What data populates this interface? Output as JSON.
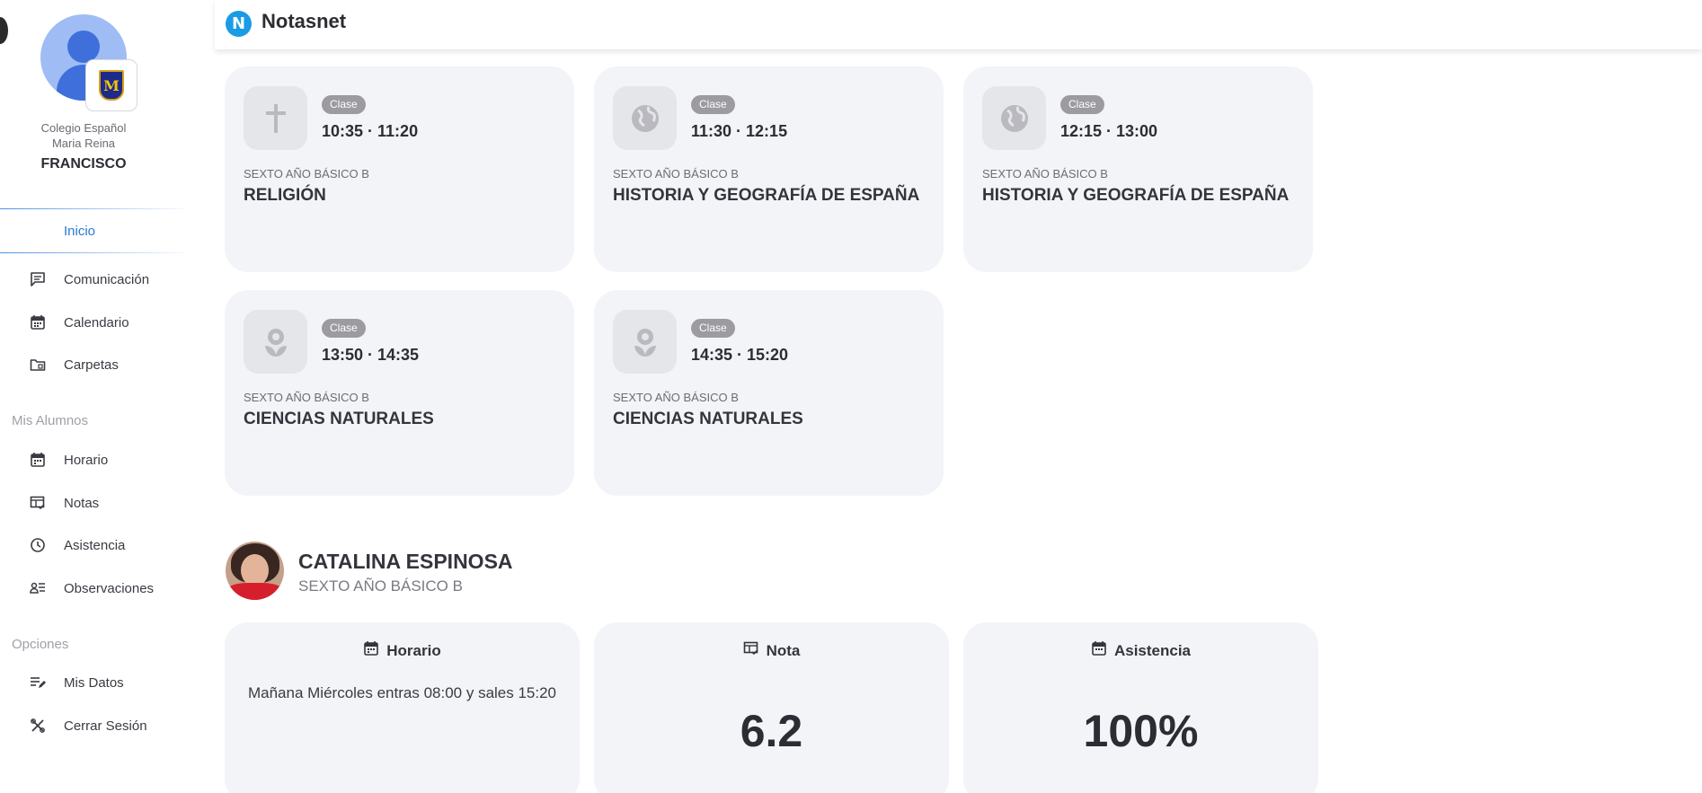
{
  "app": {
    "title": "Notasnet",
    "logo_letter": "N"
  },
  "profile": {
    "school_line1": "Colegio Español",
    "school_line2": "Maria Reina",
    "user_name": "FRANCISCO"
  },
  "nav": {
    "active_label": "Inicio",
    "main_items": [
      {
        "label": "Comunicación",
        "icon": "chat-icon"
      },
      {
        "label": "Calendario",
        "icon": "calendar-icon"
      },
      {
        "label": "Carpetas",
        "icon": "folder-icon"
      }
    ],
    "section_students": "Mis Alumnos",
    "student_items": [
      {
        "label": "Horario",
        "icon": "calendar-icon"
      },
      {
        "label": "Notas",
        "icon": "grades-table-icon"
      },
      {
        "label": "Asistencia",
        "icon": "clock-icon"
      },
      {
        "label": "Observaciones",
        "icon": "person-notes-icon"
      }
    ],
    "section_options": "Opciones",
    "option_items": [
      {
        "label": "Mis Datos",
        "icon": "edit-list-icon"
      },
      {
        "label": "Cerrar Sesión",
        "icon": "logout-tools-icon"
      }
    ]
  },
  "classes": [
    {
      "pill": "Clase",
      "time": "10:35 · 11:20",
      "grade": "SEXTO AÑO BÁSICO B",
      "subject": "RELIGIÓN",
      "icon": "cross-icon"
    },
    {
      "pill": "Clase",
      "time": "11:30 · 12:15",
      "grade": "SEXTO AÑO BÁSICO B",
      "subject": "HISTORIA Y GEOGRAFÍA DE ESPAÑA",
      "icon": "globe-icon"
    },
    {
      "pill": "Clase",
      "time": "12:15 · 13:00",
      "grade": "SEXTO AÑO BÁSICO B",
      "subject": "HISTORIA Y GEOGRAFÍA DE ESPAÑA",
      "icon": "globe-icon"
    },
    {
      "pill": "Clase",
      "time": "13:50 · 14:35",
      "grade": "SEXTO AÑO BÁSICO B",
      "subject": "CIENCIAS NATURALES",
      "icon": "flower-icon"
    },
    {
      "pill": "Clase",
      "time": "14:35 · 15:20",
      "grade": "SEXTO AÑO BÁSICO B",
      "subject": "CIENCIAS NATURALES",
      "icon": "flower-icon"
    }
  ],
  "student": {
    "name": "CATALINA ESPINOSA",
    "grade": "SEXTO AÑO BÁSICO B"
  },
  "summary": {
    "schedule": {
      "title": "Horario",
      "text": "Mañana Miércoles entras 08:00 y sales 15:20"
    },
    "grade": {
      "title": "Nota",
      "value": "6.2"
    },
    "attendance": {
      "title": "Asistencia",
      "value": "100%"
    }
  },
  "colors": {
    "accent": "#2a77d6",
    "logo": "#1a9be6",
    "card_bg": "#f3f4f8",
    "pill": "#9b9ba0"
  }
}
